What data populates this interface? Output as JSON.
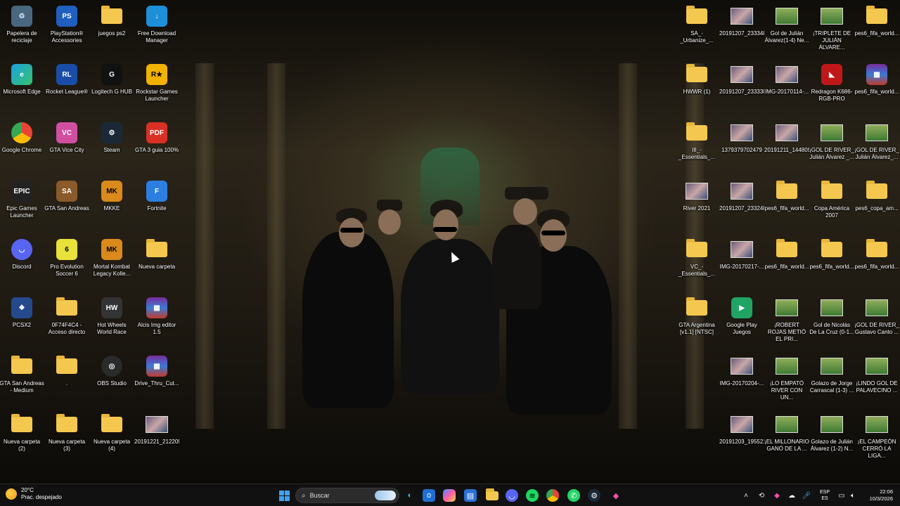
{
  "desktop": {
    "left_icons": [
      {
        "label": "Papelera de reciclaje",
        "icon": "recycle-bin-icon"
      },
      {
        "label": "PlayStation® Accessories",
        "icon": "playstation-icon"
      },
      {
        "label": "juegos ps2",
        "icon": "folder-icon"
      },
      {
        "label": "Free Download Manager",
        "icon": "download-manager-icon"
      },
      {
        "label": "Microsoft Edge",
        "icon": "edge-icon"
      },
      {
        "label": "Rocket League®",
        "icon": "rocket-league-icon"
      },
      {
        "label": "Logitech G HUB",
        "icon": "logitech-icon"
      },
      {
        "label": "Rockstar Games Launcher",
        "icon": "rockstar-icon"
      },
      {
        "label": "Google Chrome",
        "icon": "chrome-icon"
      },
      {
        "label": "GTA Vice City",
        "icon": "gta-vice-city-icon"
      },
      {
        "label": "Steam",
        "icon": "steam-icon"
      },
      {
        "label": "GTA 3 guia 100%",
        "icon": "pdf-icon"
      },
      {
        "label": "Epic Games Launcher",
        "icon": "epic-games-icon"
      },
      {
        "label": "GTA San Andreas",
        "icon": "gta-san-andreas-icon"
      },
      {
        "label": "MKKE",
        "icon": "mortal-kombat-icon"
      },
      {
        "label": "Fortnite",
        "icon": "fortnite-icon"
      },
      {
        "label": "Discord",
        "icon": "discord-icon"
      },
      {
        "label": "Pro Evolution Soccer 6",
        "icon": "pes6-icon"
      },
      {
        "label": "Mortal Kombat Legacy Kolle...",
        "icon": "mortal-kombat-icon"
      },
      {
        "label": "Nueva carpeta",
        "icon": "folder-icon"
      },
      {
        "label": "PCSX2",
        "icon": "pcsx2-icon"
      },
      {
        "label": "0F74F4C4 - Acceso directo",
        "icon": "folder-icon"
      },
      {
        "label": "Hot Wheels World Race",
        "icon": "hot-wheels-icon"
      },
      {
        "label": "Alcis Img editor 1.5",
        "icon": "winrar-icon"
      },
      {
        "label": "GTA San Andreas - Medium",
        "icon": "folder-icon"
      },
      {
        "label": ".",
        "icon": "folder-icon"
      },
      {
        "label": "OBS Studio",
        "icon": "obs-icon"
      },
      {
        "label": "Drive_Thru_Cut...",
        "icon": "winrar-icon"
      },
      {
        "label": "Nueva carpeta (2)",
        "icon": "folder-icon"
      },
      {
        "label": "Nueva carpeta (3)",
        "icon": "folder-icon"
      },
      {
        "label": "Nueva carpeta (4)",
        "icon": "folder-icon"
      },
      {
        "label": "20191221_212209",
        "icon": "image-thumb-icon"
      }
    ],
    "right_icons": [
      {
        "label": "SA_-_Urbanize_...",
        "icon": "folder-icon"
      },
      {
        "label": "20191207_233348",
        "icon": "image-thumb-icon"
      },
      {
        "label": "Gol de Julián Álvarez(1-4) Ne...",
        "icon": "video-thumb-icon"
      },
      {
        "label": "¡TRIPLETE DE JULIÁN ÁLVARE...",
        "icon": "video-thumb-icon"
      },
      {
        "label": "pes6_fifa_world...",
        "icon": "folder-icon"
      },
      {
        "label": "HWWR (1)",
        "icon": "folder-icon"
      },
      {
        "label": "20191207_233330",
        "icon": "image-thumb-icon"
      },
      {
        "label": "IMG-20170114-...",
        "icon": "image-thumb-icon"
      },
      {
        "label": "Redragon K686-RGB-PRO",
        "icon": "redragon-icon"
      },
      {
        "label": "pes6_fifa_world...",
        "icon": "winrar-icon"
      },
      {
        "label": "III_-_Essentials_...",
        "icon": "folder-icon"
      },
      {
        "label": "1379379702479",
        "icon": "image-thumb-icon"
      },
      {
        "label": "20191211_144809",
        "icon": "image-thumb-icon"
      },
      {
        "label": "¡GOL DE RIVER_ Julián Álvarez _...",
        "icon": "video-thumb-icon"
      },
      {
        "label": "¡GOL DE RIVER_ Julián Álvarez_...",
        "icon": "video-thumb-icon"
      },
      {
        "label": "River 2021",
        "icon": "image-thumb-icon"
      },
      {
        "label": "20191207_233248",
        "icon": "image-thumb-icon"
      },
      {
        "label": "pes6_fifa_world...",
        "icon": "folder-icon"
      },
      {
        "label": "Copa América 2007",
        "icon": "folder-icon"
      },
      {
        "label": "pes6_copa_am...",
        "icon": "folder-icon"
      },
      {
        "label": "VC_-_Essentials_...",
        "icon": "folder-icon"
      },
      {
        "label": "IMG-20170217-...",
        "icon": "image-thumb-icon"
      },
      {
        "label": "pes6_fifa_world...",
        "icon": "folder-icon"
      },
      {
        "label": "pes6_fifa_world...",
        "icon": "folder-icon"
      },
      {
        "label": "pes6_fifa_world...",
        "icon": "folder-icon"
      },
      {
        "label": "GTA Argentina [v1.1] [NTSC]",
        "icon": "folder-icon"
      },
      {
        "label": "Google Play Juegos",
        "icon": "google-play-games-icon"
      },
      {
        "label": "¡ROBERT ROJAS METIÓ EL PRI...",
        "icon": "video-thumb-icon"
      },
      {
        "label": "Gol de Nicolás De La Cruz (0-1...",
        "icon": "video-thumb-icon"
      },
      {
        "label": "¡GOL DE RIVER_ Gustavo Canto ...",
        "icon": "video-thumb-icon"
      },
      {
        "label": "IMG-20170204-...",
        "icon": "image-thumb-icon"
      },
      {
        "label": "¡LO EMPATÓ RIVER CON UN...",
        "icon": "video-thumb-icon"
      },
      {
        "label": "Golazo de Jorge Carrascal (1-3) ...",
        "icon": "video-thumb-icon"
      },
      {
        "label": "¡LINDO GOL DE PALAVECINO ...",
        "icon": "video-thumb-icon"
      },
      {
        "label": "20191203_195521",
        "icon": "image-thumb-icon"
      },
      {
        "label": "¡EL MILLONARIO GANÓ DE LA ...",
        "icon": "video-thumb-icon"
      },
      {
        "label": "Golazo de Julián Álvarez (1-2) N...",
        "icon": "video-thumb-icon"
      },
      {
        "label": "¡EL CAMPEÓN CERRÓ LA LIGA...",
        "icon": "video-thumb-icon"
      }
    ]
  },
  "taskbar": {
    "weather": {
      "temp": "20°C",
      "desc": "Prac. despejado"
    },
    "search_placeholder": "Buscar",
    "pinned": [
      "edge-icon",
      "outlook-icon",
      "copilot-icon",
      "store-icon",
      "file-explorer-icon",
      "discord-icon",
      "spotify-icon",
      "chrome-icon",
      "whatsapp-icon",
      "steam-icon",
      "app-icon"
    ],
    "lang": {
      "top": "ESP",
      "bottom": "ES"
    },
    "clock": {
      "time": "22:06",
      "date": "10/3/2026"
    }
  },
  "colors": {
    "folder": "#f4c84f",
    "accent": "#3fa2f7",
    "taskbar": "#121212"
  }
}
